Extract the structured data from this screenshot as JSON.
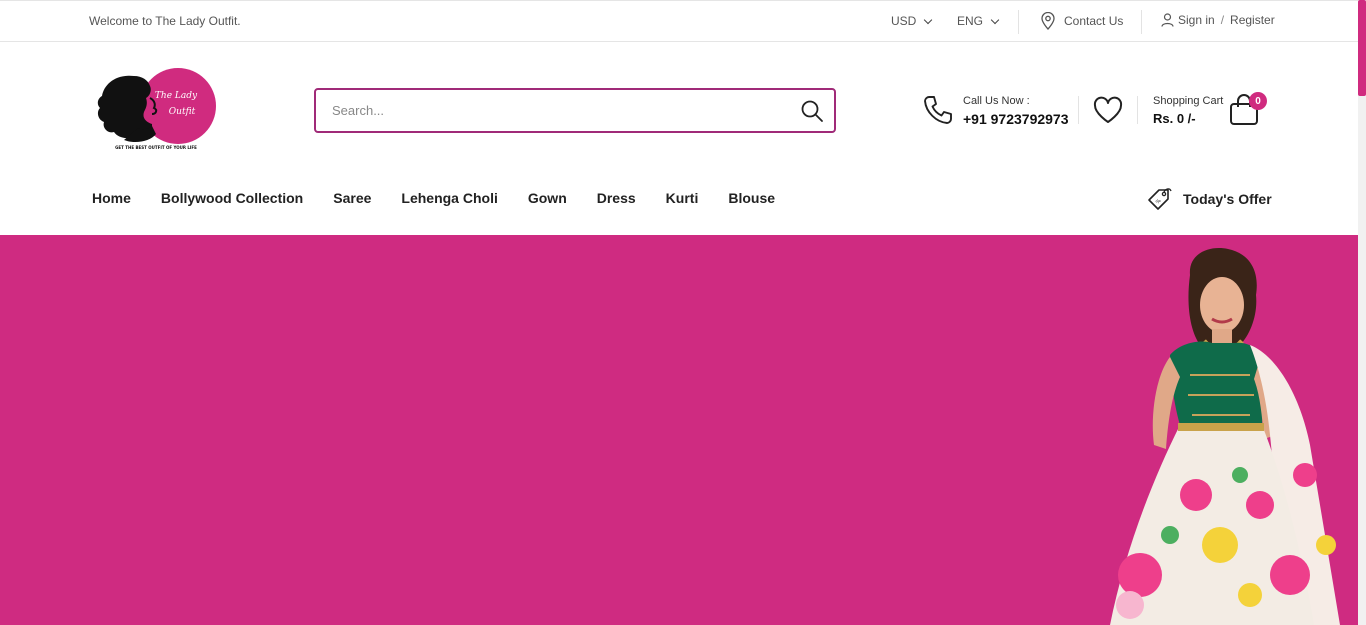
{
  "topbar": {
    "welcome": "Welcome to The Lady Outfit.",
    "currency": "USD",
    "language": "ENG",
    "contact": "Contact Us",
    "signin": "Sign in",
    "slash": "/",
    "register": "Register"
  },
  "search": {
    "placeholder": "Search..."
  },
  "header": {
    "call_label": "Call Us Now :",
    "call_number": "+91 9723792973",
    "cart_label": "Shopping Cart",
    "cart_total": "Rs. 0 /-",
    "cart_count": "0"
  },
  "logo": {
    "text_line1": "The Lady",
    "text_line2": "Outfit",
    "tagline": "GET THE BEST OUTFIT OF YOUR LIFE"
  },
  "nav": {
    "items": [
      "Home",
      "Bollywood Collection",
      "Saree",
      "Lehenga Choli",
      "Gown",
      "Dress",
      "Kurti",
      "Blouse"
    ],
    "offer": "Today's Offer"
  },
  "colors": {
    "brand_pink": "#cf2b81",
    "search_border": "#a02a78"
  }
}
